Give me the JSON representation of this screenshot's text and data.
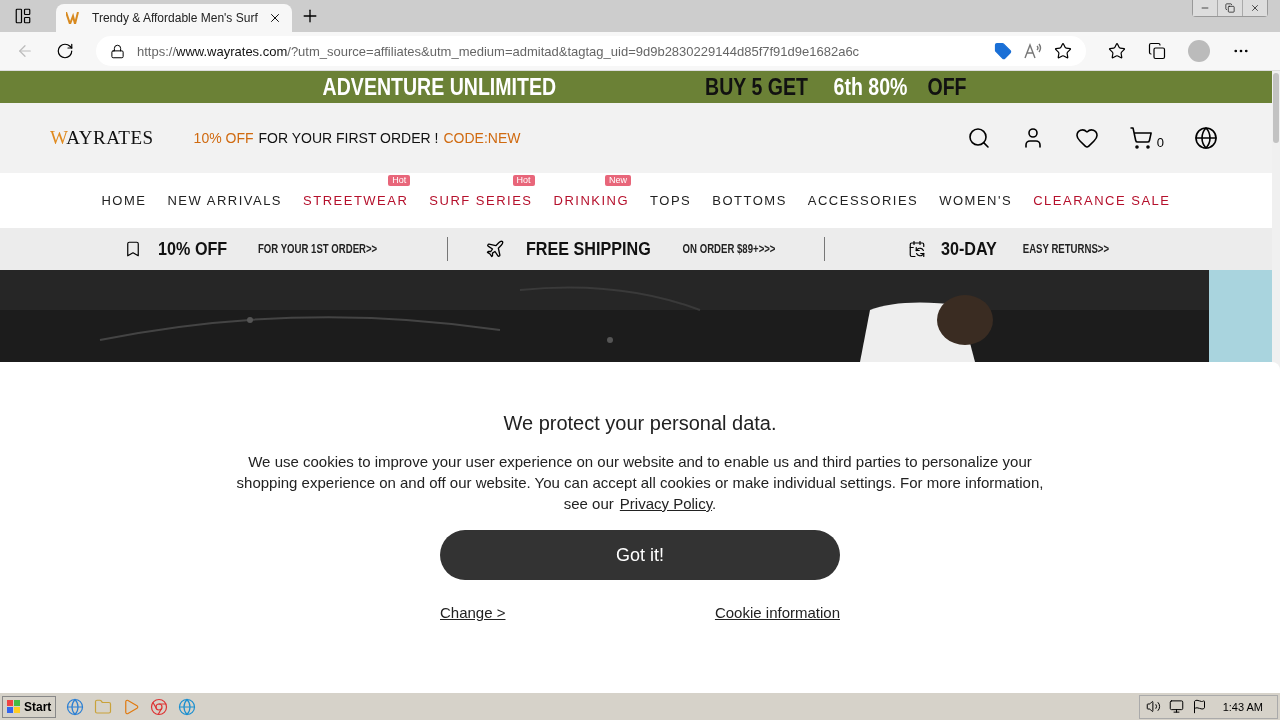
{
  "browser": {
    "tab_title": "Trendy & Affordable Men's Surf",
    "url": {
      "scheme": "https://",
      "host": "www.wayrates.com",
      "path": "/?utm_source=affiliates&utm_medium=admitad&tagtag_uid=9d9b2830229144d85f7f91d9e1682a6c"
    }
  },
  "banner": [
    {
      "text": "ADVENTURE UNLIMITED",
      "highlight": true
    },
    {
      "text": "BUY 5 GET",
      "highlight": false
    },
    {
      "text": "6th 80%",
      "highlight": true
    },
    {
      "text": "OFF",
      "highlight": false
    }
  ],
  "header": {
    "logo": "WAYRATES",
    "promo": [
      {
        "text": "10% OFF",
        "highlight": true
      },
      {
        "text": "FOR YOUR FIRST ORDER !",
        "highlight": false
      },
      {
        "text": "CODE:NEW",
        "highlight": true
      }
    ],
    "cart_count": "0"
  },
  "nav": [
    {
      "label": "HOME",
      "kind": "normal"
    },
    {
      "label": "NEW ARRIVALS",
      "kind": "normal"
    },
    {
      "label": "STREETWEAR",
      "kind": "sale",
      "badge": "Hot"
    },
    {
      "label": "SURF SERIES",
      "kind": "sale",
      "badge": "Hot"
    },
    {
      "label": "DRINKING",
      "kind": "sale",
      "badge": "New"
    },
    {
      "label": "TOPS",
      "kind": "normal"
    },
    {
      "label": "BOTTOMS",
      "kind": "normal"
    },
    {
      "label": "ACCESSORIES",
      "kind": "normal"
    },
    {
      "label": "WOMEN'S",
      "kind": "normal"
    },
    {
      "label": "CLEARANCE SALE",
      "kind": "sale"
    }
  ],
  "perks": [
    {
      "kind": "bookmark",
      "title": "10% OFF",
      "subtitle": "FOR YOUR 1ST ORDER>>"
    },
    {
      "kind": "plane",
      "title": "FREE SHIPPING",
      "subtitle": "ON ORDER $89+>>>"
    },
    {
      "kind": "returns",
      "title": "30-DAY",
      "subtitle": "EASY RETURNS>>"
    }
  ],
  "cookie_dialog": {
    "title": "We protect your personal data.",
    "text": "We use cookies to improve your user experience on our website and to enable us and third parties to personalize your shopping experience on and off our website. You can accept all cookies or make individual settings. For more information, see our",
    "link": "Privacy Policy",
    "link_suffix": ".",
    "button": "Got it!",
    "links": [
      "Change >",
      "Cookie information"
    ]
  },
  "taskbar": {
    "start": "Start",
    "time": "1:43 AM"
  }
}
